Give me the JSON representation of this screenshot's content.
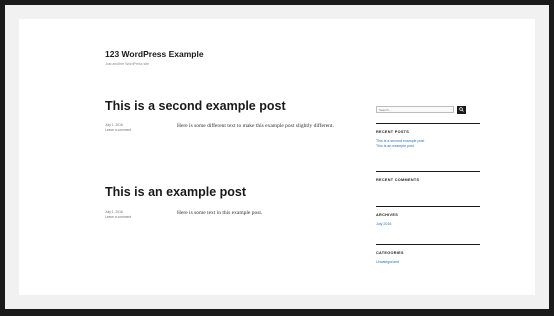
{
  "site": {
    "title": "123 WordPress Example",
    "description": "Just another WordPress site"
  },
  "posts": [
    {
      "title": "This is a second example post",
      "date": "July 1, 2016",
      "comments": "Leave a comment",
      "body": "Here is some different text to make this example post slightly different."
    },
    {
      "title": "This is an example post",
      "date": "July 1, 2016",
      "comments": "Leave a comment",
      "body": "Here is some text in this example post."
    }
  ],
  "sidebar": {
    "search": {
      "placeholder": "Search …",
      "icon": "search-icon"
    },
    "recent_posts": {
      "title": "RECENT POSTS",
      "items": [
        "This is a second example post",
        "This is an example post"
      ]
    },
    "recent_comments": {
      "title": "RECENT COMMENTS"
    },
    "archives": {
      "title": "ARCHIVES",
      "items": [
        "July 2016"
      ]
    },
    "categories": {
      "title": "CATEGORIES",
      "items": [
        "Uncategorized"
      ]
    }
  },
  "colors": {
    "accent": "#2b6fb6",
    "text": "#1a1a1a",
    "frame": "#1a1a1a"
  }
}
